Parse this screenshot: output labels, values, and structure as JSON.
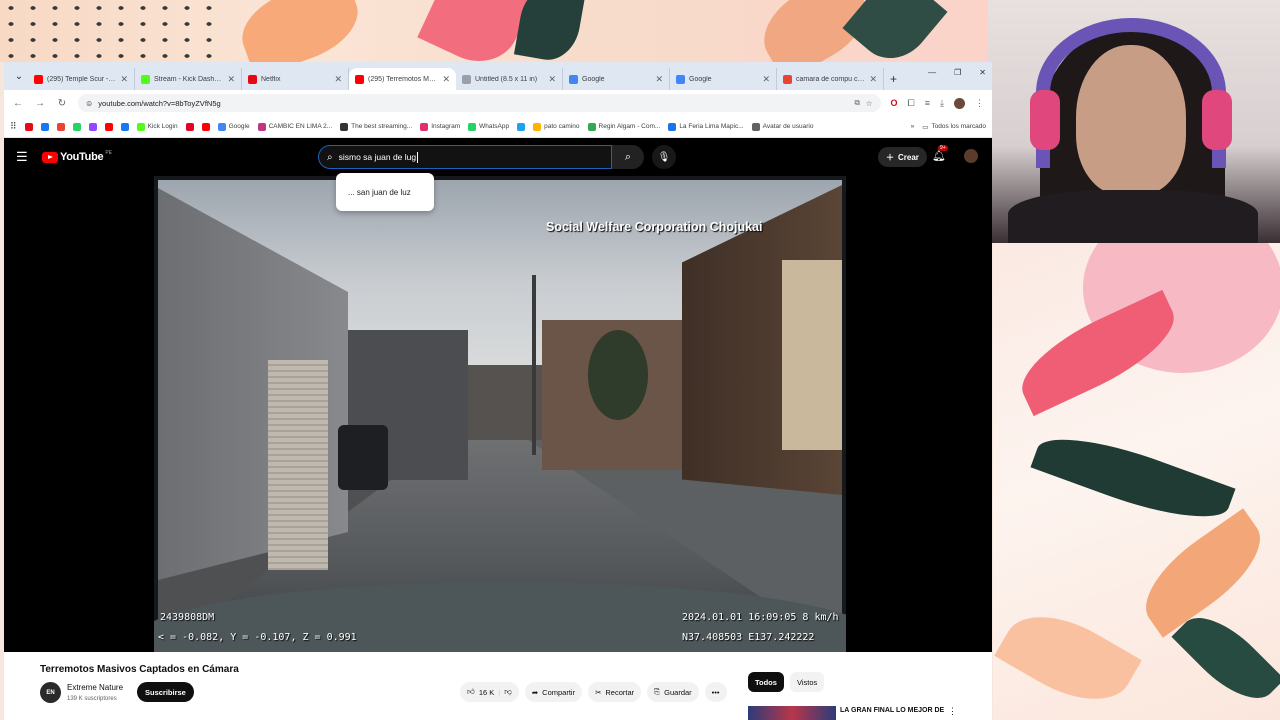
{
  "browser": {
    "tabs": [
      {
        "title": "(295) Temple Scur - Verte",
        "color": "#ff0000"
      },
      {
        "title": "Stream - Kick Dashboard",
        "color": "#53fc18"
      },
      {
        "title": "Netflix",
        "color": "#e50914"
      },
      {
        "title": "(295) Terremotos Masivos",
        "color": "#ff0000"
      },
      {
        "title": "Untitled (8.5 x 11 in)",
        "color": "#9aa0a6"
      },
      {
        "title": "Google",
        "color": "#4285f4"
      },
      {
        "title": "Google",
        "color": "#4285f4"
      },
      {
        "title": "camara de compu con el",
        "color": "#ea4335"
      }
    ],
    "new_tab": "+",
    "url": "youtube.com/watch?v=8bToyZVfN5g",
    "bookmarks": [
      {
        "label": "",
        "color": "#e50914"
      },
      {
        "label": "",
        "color": "#1877f2"
      },
      {
        "label": "",
        "color": "#ea4335"
      },
      {
        "label": "",
        "color": "#25d366"
      },
      {
        "label": "",
        "color": "#9146ff"
      },
      {
        "label": "",
        "color": "#ff0000"
      },
      {
        "label": "",
        "color": "#1877f2"
      },
      {
        "label": "Kick Login",
        "color": "#53fc18"
      },
      {
        "label": "",
        "color": "#e60023"
      },
      {
        "label": "",
        "color": "#ff0000"
      },
      {
        "label": "Google",
        "color": "#4285f4"
      },
      {
        "label": "CAMBIC EN LIMA 2...",
        "color": "#c13584"
      },
      {
        "label": "The best streaming...",
        "color": "#333333"
      },
      {
        "label": "Instagram",
        "color": "#e1306c"
      },
      {
        "label": "WhatsApp",
        "color": "#25d366"
      },
      {
        "label": "",
        "color": "#1da1f2"
      },
      {
        "label": "pato camino",
        "color": "#ffb300"
      },
      {
        "label": "Regin Algam - Com...",
        "color": "#34a853"
      },
      {
        "label": "La Feria Lima Mapic...",
        "color": "#1a73e8"
      },
      {
        "label": "Avatar de usuario",
        "color": "#5f6368"
      }
    ],
    "all_bookmarks": "Todos los marcado"
  },
  "youtube": {
    "logo": "YouTube",
    "logo_region": "PE",
    "search_value": "sismo sa juan de lug",
    "suggestion": "... san juan de luz",
    "create_label": "Crear",
    "notif_badge": "9+",
    "video": {
      "overlay_title": "Social Welfare Corporation Chojukai",
      "code": "2439808DM",
      "coords": "< = -0.082, Y = -0.107, Z = 0.991",
      "datetime": "2024.01.01 16:09:05   8 km/h",
      "gps": "N37.408503  E137.242222"
    },
    "title": "Terremotos Masivos Captados en Cámara",
    "channel": {
      "initials": "EN",
      "name": "Extreme Nature",
      "subs": "139 K suscriptores"
    },
    "subscribe_label": "Suscribirse",
    "actions": {
      "likes": "16 K",
      "share": "Compartir",
      "clip": "Recortar",
      "save": "Guardar"
    },
    "chips": [
      "Todos",
      "Vistos"
    ],
    "rec_title": "LA GRAN FINAL   LO MEJOR DE"
  }
}
